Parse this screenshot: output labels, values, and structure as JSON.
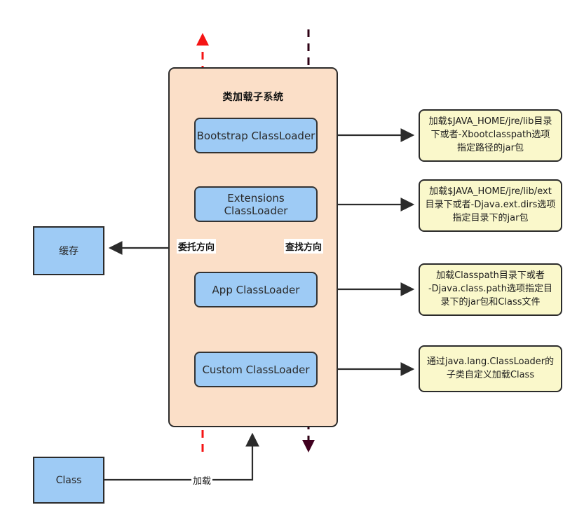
{
  "diagram": {
    "container": {
      "title": "类加载子系统"
    },
    "loaders": [
      {
        "label": "Bootstrap ClassLoader"
      },
      {
        "label": "Extensions ClassLoader"
      },
      {
        "label": "App ClassLoader"
      },
      {
        "label": "Custom ClassLoader"
      }
    ],
    "notes": [
      {
        "text": "加载$JAVA_HOME/jre/lib目录\n下或者-Xbootclasspath选项\n指定路径的jar包"
      },
      {
        "text": "加载$JAVA_HOME/jre/lib/ext\n目录下或者-Djava.ext.dirs选项\n指定目录下的jar包"
      },
      {
        "text": "加载Classpath目录下或者\n-Djava.class.path选项指定目\n录下的jar包和Class文件"
      },
      {
        "text": "通过java.lang.ClassLoader的\n子类自定义加载Class"
      }
    ],
    "side_boxes": {
      "cache": {
        "label": "缓存"
      },
      "class": {
        "label": "Class"
      }
    },
    "direction_labels": {
      "delegate": "委托方向",
      "lookup": "查找方向"
    },
    "edge_labels": {
      "load": "加载"
    },
    "colors": {
      "container_fill": "#fbdfc8",
      "loader_fill": "#9ecbf5",
      "note_fill": "#faf8cb",
      "stroke": "#2b2b2b",
      "delegate_line": "#f51414",
      "lookup_line": "#2d0014"
    }
  }
}
